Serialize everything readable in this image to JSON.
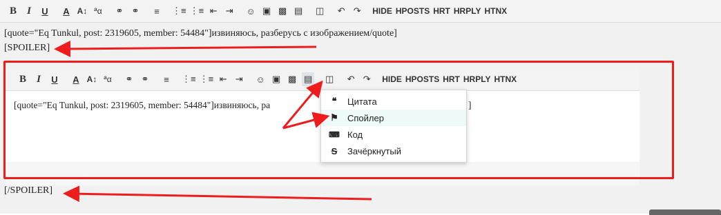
{
  "toolbar": {
    "hide": "HIDE",
    "hposts": "HPOSTS",
    "hrt": "HRT",
    "hrply": "HRPLY",
    "htnx": "HTNX"
  },
  "editor": {
    "quote_line": "[quote=\"Eq Tunkul, post: 2319605, member: 54484\"]извиняюсь, разберусь с изображением/quote]",
    "spoiler_open": "[SPOILER]",
    "spoiler_close": "[/SPOILER]"
  },
  "inner_editor": {
    "text": "[quote=\"Eq Tunkul, post: 2319605, member: 54484\"]извиняюсь, ра",
    "text_tail": "]"
  },
  "dropdown": {
    "items": [
      {
        "label": "Цитата",
        "icon": "quote-icon"
      },
      {
        "label": "Спойлер",
        "icon": "flag-icon"
      },
      {
        "label": "Код",
        "icon": "code-icon"
      },
      {
        "label": "Зачёркнутый",
        "icon": "strikethrough-icon"
      }
    ]
  },
  "colors": {
    "annotation": "#ee1c1c",
    "toolbar_bg": "#f3f3f3",
    "hover": "#eefaf7"
  }
}
